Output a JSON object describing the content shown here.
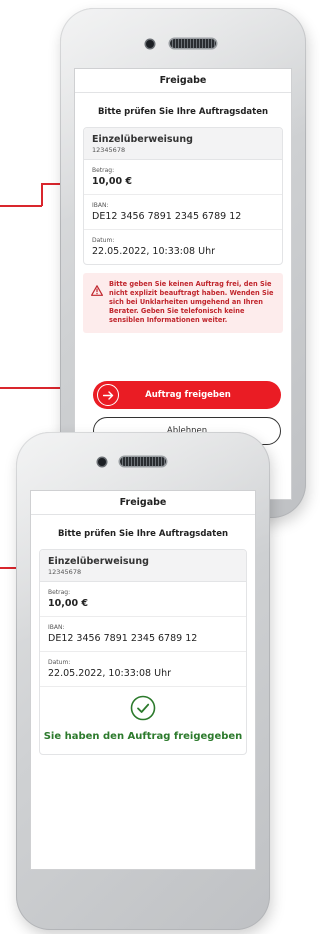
{
  "colors": {
    "accent": "#ea1c24",
    "warning_bg": "#fdecec",
    "success": "#2c7a2c"
  },
  "phone1": {
    "header": "Freigabe",
    "subtitle": "Bitte prüfen Sie Ihre Auftragsdaten",
    "card": {
      "title": "Einzelüberweisung",
      "account": "12345678",
      "fields": [
        {
          "label": "Betrag:",
          "value": "10,00 €"
        },
        {
          "label": "IBAN:",
          "value": "DE12 3456 7891 2345 6789 12"
        },
        {
          "label": "Datum:",
          "value": "22.05.2022, 10:33:08 Uhr"
        }
      ]
    },
    "warning": {
      "icon": "warning-triangle-icon",
      "text": "Bitte geben Sie keinen Auftrag frei, den Sie nicht explizit beauftragt haben. Wenden Sie sich bei Unklarheiten umgehend an Ihren Berater. Geben Sie telefonisch keine sensiblen Informationen weiter."
    },
    "approve_button": {
      "icon": "arrow-right-icon",
      "label": "Auftrag freigeben"
    },
    "reject_button": {
      "label": "Ablehnen"
    }
  },
  "phone2": {
    "header": "Freigabe",
    "subtitle": "Bitte prüfen Sie Ihre Auftragsdaten",
    "card": {
      "title": "Einzelüberweisung",
      "account": "12345678",
      "fields": [
        {
          "label": "Betrag:",
          "value": "10,00 €"
        },
        {
          "label": "IBAN:",
          "value": "DE12 3456 7891 2345 6789 12"
        },
        {
          "label": "Datum:",
          "value": "22.05.2022, 10:33:08 Uhr"
        }
      ]
    },
    "success": {
      "icon": "checkmark-circle-icon",
      "text": "Sie haben den Auftrag freigegeben"
    }
  }
}
